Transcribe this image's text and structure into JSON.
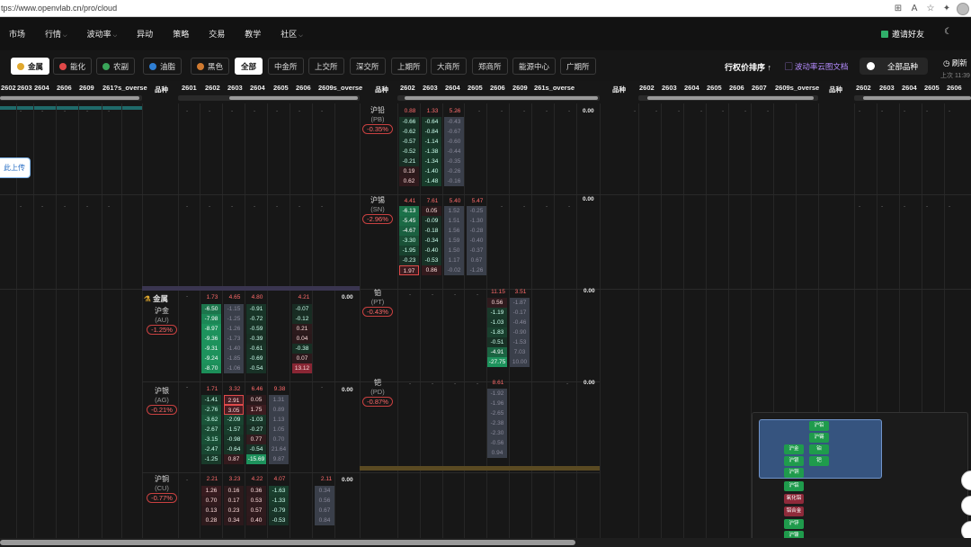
{
  "browser": {
    "url": "tps://www.openvlab.cn/pro/cloud",
    "icons": [
      "grid-icon",
      "font-size-icon",
      "star-icon",
      "extensions-icon"
    ]
  },
  "nav": {
    "items": [
      {
        "label": "市场",
        "chev": false
      },
      {
        "label": "行情",
        "chev": true
      },
      {
        "label": "波动率",
        "chev": true
      },
      {
        "label": "异动",
        "chev": false
      },
      {
        "label": "策略",
        "chev": false
      },
      {
        "label": "交易",
        "chev": false
      },
      {
        "label": "教学",
        "chev": false
      },
      {
        "label": "社区",
        "chev": true
      }
    ],
    "invite": "邀请好友"
  },
  "filters": {
    "categories": [
      {
        "label": "金属",
        "active": true,
        "color": "#e0a82e"
      },
      {
        "label": "能化",
        "active": false,
        "color": "#e04848"
      },
      {
        "label": "农副",
        "active": false,
        "color": "#3aa65a"
      },
      {
        "label": "油脂",
        "active": false,
        "color": "#2f7fd4"
      },
      {
        "label": "黑色",
        "active": false,
        "color": "#d07a30"
      }
    ],
    "exchanges": [
      {
        "label": "全部",
        "active": true
      },
      {
        "label": "中金所",
        "active": false
      },
      {
        "label": "上交所",
        "active": false
      },
      {
        "label": "深交所",
        "active": false
      },
      {
        "label": "上期所",
        "active": false
      },
      {
        "label": "大商所",
        "active": false
      },
      {
        "label": "郑商所",
        "active": false
      },
      {
        "label": "能源中心",
        "active": false
      },
      {
        "label": "广期所",
        "active": false
      }
    ],
    "sort_label": "行权价排序",
    "doc_link": "波动率云图文档",
    "all_toggle": "全部品种",
    "refresh": "刷新",
    "updated": "上次 11:39"
  },
  "table": {
    "header_cols_a": [
      "2602",
      "2603",
      "2604",
      "2606",
      "2609",
      "261?s_overse"
    ],
    "header_cols_b": [
      "2601",
      "2602",
      "2603",
      "2604",
      "2605",
      "2606",
      "2609s_overse"
    ],
    "header_cols_c": [
      "2602",
      "2603",
      "2604",
      "2605",
      "2606",
      "2609",
      "261s_overse"
    ],
    "header_cols_d": [
      "2603",
      "2604",
      "2605",
      "2606",
      "2607",
      "2609s_overse"
    ],
    "header_cols_e": [
      "2602",
      "2603",
      "2604",
      "2605",
      "2606",
      "2607"
    ],
    "pinzhong": "品种",
    "upload_hint": "此上传",
    "metals_group": "金属"
  },
  "products": {
    "au": {
      "name": "沪金",
      "code": "(AU)",
      "pct": "-1.25%",
      "head": [
        "1.73",
        "4.65",
        "4.80",
        "",
        "4.21"
      ],
      "c2602": [
        "-6.50",
        "-7.98",
        "-8.97",
        "-9.36",
        "-9.31",
        "-9.24",
        "-8.70"
      ],
      "c2603": [
        "-1.15",
        "-1.25",
        "-1.26",
        "-1.73",
        "-1.40",
        "-1.85",
        "-1.06"
      ],
      "c2604": [
        "-0.91",
        "-0.72",
        "-0.59",
        "-0.39",
        "-0.61",
        "-0.69",
        "-0.54"
      ],
      "c2606": [
        "-0.07",
        "-0.12",
        "0.21",
        "0.04",
        "-0.38",
        "0.07",
        "13.12"
      ],
      "zero": "0.00"
    },
    "ag": {
      "name": "沪银",
      "code": "(AG)",
      "pct": "-0.21%",
      "head": [
        "1.71",
        "3.32",
        "6.46",
        "9.38"
      ],
      "c2602": [
        "-1.41",
        "-2.76",
        "-3.62",
        "-2.67",
        "-3.15",
        "-2.47",
        "-1.25"
      ],
      "c2603": [
        "2.91",
        "3.05",
        "-2.09",
        "-1.57",
        "-0.98",
        "-0.64",
        "0.87"
      ],
      "c2604": [
        "0.05",
        "1.75",
        "-1.03",
        "-0.27",
        "0.77",
        "-0.54",
        "-15.69"
      ],
      "c2605": [
        "1.31",
        "0.89",
        "1.13",
        "1.05",
        "0.70",
        "21.64",
        "9.87"
      ],
      "zero": "0.00"
    },
    "cu": {
      "name": "沪铜",
      "code": "(CU)",
      "pct": "-0.77%",
      "head": [
        "2.21",
        "3.23",
        "4.22",
        "4.07",
        "",
        "2.11"
      ],
      "c2602": [
        "1.26",
        "0.70",
        "0.13",
        "0.28"
      ],
      "c2603": [
        "0.16",
        "0.17",
        "0.23",
        "0.34"
      ],
      "c2604": [
        "0.36",
        "0.53",
        "0.57",
        "0.40"
      ],
      "c2605": [
        "-1.63",
        "-1.33",
        "-0.79",
        "-0.53"
      ],
      "c2607": [
        "0.34",
        "0.56",
        "0.67",
        "0.84"
      ],
      "zero": "0.00"
    },
    "pb": {
      "name": "沪铅",
      "code": "(PB)",
      "pct": "-0.35%",
      "head": [
        "0.88",
        "1.33",
        "5.26"
      ],
      "c2602": [
        "-0.66",
        "-0.62",
        "-0.57",
        "-0.52",
        "-0.21",
        "0.19",
        "0.62"
      ],
      "c2603": [
        "-0.64",
        "-0.84",
        "-1.14",
        "-1.38",
        "-1.34",
        "-1.40",
        "-1.48"
      ],
      "c2604": [
        "-0.43",
        "-0.67",
        "-0.60",
        "-0.44",
        "-0.35",
        "-0.26",
        "-0.16"
      ],
      "zero": "0.00"
    },
    "sn": {
      "name": "沪锡",
      "code": "(SN)",
      "pct": "-2.96%",
      "head": [
        "4.41",
        "7.61",
        "5.40",
        "5.47"
      ],
      "c2602": [
        "-6.13",
        "-5.45",
        "-4.67",
        "-3.30",
        "-1.95",
        "-0.23",
        "1.97"
      ],
      "c2603": [
        "0.05",
        "-0.09",
        "-0.18",
        "-0.34",
        "-0.40",
        "-0.53",
        "0.86"
      ],
      "c2604": [
        "1.52",
        "1.51",
        "1.56",
        "1.59",
        "1.50",
        "1.17",
        "-0.02"
      ],
      "c2605": [
        "-0.25",
        "-1.30",
        "-0.28",
        "-0.40",
        "-0.37",
        "0.67",
        "-1.26"
      ],
      "zero": "0.00"
    },
    "pt": {
      "name": "铂",
      "code": "(PT)",
      "pct": "-0.43%",
      "head": [
        "11.15",
        "3.51"
      ],
      "c2606": [
        "0.56",
        "-1.19",
        "-1.03",
        "-1.83",
        "-0.51",
        "-4.91",
        "-27.75"
      ],
      "c2607": [
        "-1.87",
        "-0.17",
        "-0.46",
        "-0.90",
        "-1.53",
        "7.03",
        "10.00"
      ],
      "zero": "0.00"
    },
    "pd": {
      "name": "钯",
      "code": "(PD)",
      "pct": "-0.87%",
      "head": [
        "8.61"
      ],
      "c2606": [
        "-1.92",
        "-1.96",
        "-2.65",
        "-2.38",
        "-2.30",
        "-0.56",
        "0.94"
      ],
      "zero": "0.00"
    }
  },
  "minimap": {
    "labels": [
      "沪铅",
      "沪锡",
      "沪金",
      "铂",
      "沪银",
      "钯",
      "沪铜",
      "沪铝",
      "氧化铝",
      "铝合金",
      "沪锌",
      "沪镍"
    ]
  }
}
